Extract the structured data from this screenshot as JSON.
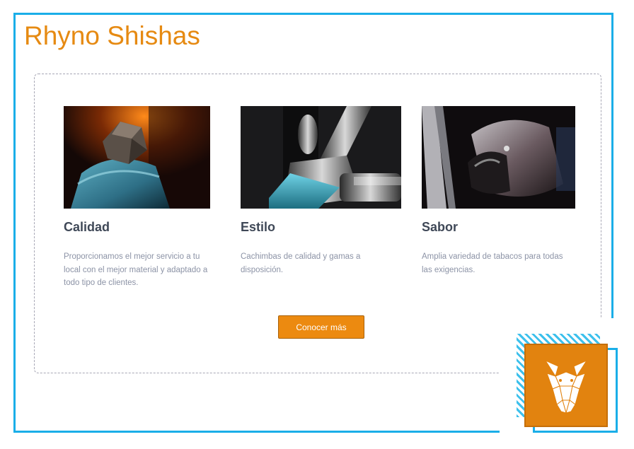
{
  "page": {
    "title": "Rhyno Shishas"
  },
  "cards": [
    {
      "title": "Calidad",
      "text": "Proporcionamos el mejor servicio a tu local con el mejor material y adaptado a todo tipo de clientes.",
      "image": "hookah-bowl-coal-photo"
    },
    {
      "title": "Estilo",
      "text": "Cachimbas de calidad y gamas a disposición.",
      "image": "hookah-valve-chrome-photo"
    },
    {
      "title": "Sabor",
      "text": "Amplia variedad de tabacos para todas las exigencias.",
      "image": "hookah-hose-detail-photo"
    }
  ],
  "cta": {
    "label": "Conocer más"
  },
  "colors": {
    "accent": "#e68a12",
    "frame": "#1aaee8",
    "button": "#ec8a10",
    "heading": "#3f4857",
    "body_text": "#8c93a6"
  },
  "logo": {
    "icon": "rhino-head-icon"
  }
}
